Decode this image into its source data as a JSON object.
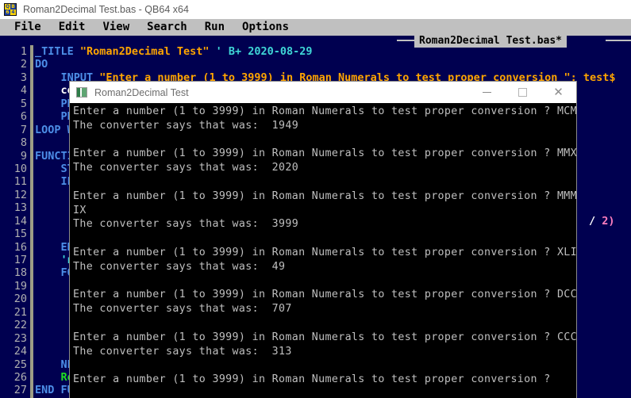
{
  "ide": {
    "title": "Roman2Decimal Test.bas - QB64 x64",
    "icon": "qb64-icon",
    "icon_text": {
      "tl": "Q",
      "tr": "B",
      "bl": "6",
      "br": "4"
    },
    "menu": [
      "File",
      "Edit",
      "View",
      "Search",
      "Run",
      "Options"
    ],
    "file_tab": "Roman2Decimal Test.bas*",
    "colors": {
      "editor_bg": "#000050",
      "menu_bg": "#c0c0c0",
      "keyword": "#4d8fe8",
      "string": "#ffa500",
      "comment": "#3fd7d7",
      "function": "#20e020",
      "gutter_text": "#b0b0b0"
    },
    "gutter_lines": [
      "1",
      "2",
      "3",
      "4",
      "5",
      "6",
      "7",
      "8",
      "9",
      "10",
      "11",
      "12",
      "13",
      "14",
      "15",
      "16",
      "17",
      "18",
      "19",
      "20",
      "21",
      "22",
      "23",
      "24",
      "25",
      "26",
      "27"
    ],
    "code_lines": [
      {
        "n": "1",
        "segments": [
          {
            "t": "_TITLE ",
            "c": "kw"
          },
          {
            "t": "\"Roman2Decimal Test\"",
            "c": "str"
          },
          {
            "t": " ' B+ 2020-08-29",
            "c": "com"
          }
        ]
      },
      {
        "n": "2",
        "segments": [
          {
            "t": "DO",
            "c": "kw"
          }
        ]
      },
      {
        "n": "3",
        "segments": [
          {
            "t": "    INPUT ",
            "c": "kw"
          },
          {
            "t": "\"Enter a number (1 to 3999) in Roman Numerals to test proper conversion \"; test$",
            "c": "str"
          }
        ]
      },
      {
        "n": "4",
        "segments": [
          {
            "t": "    con",
            "c": "plain"
          }
        ]
      },
      {
        "n": "5",
        "segments": [
          {
            "t": "    PRI",
            "c": "kw"
          }
        ]
      },
      {
        "n": "6",
        "segments": [
          {
            "t": "    PRI",
            "c": "kw"
          }
        ]
      },
      {
        "n": "7",
        "segments": [
          {
            "t": "LOOP WH",
            "c": "kw"
          }
        ]
      },
      {
        "n": "8",
        "segments": [
          {
            "t": "",
            "c": "kw"
          }
        ]
      },
      {
        "n": "9",
        "segments": [
          {
            "t": "FUNCTIO",
            "c": "kw"
          }
        ]
      },
      {
        "n": "10",
        "segments": [
          {
            "t": "    STA",
            "c": "kw"
          }
        ]
      },
      {
        "n": "11",
        "segments": [
          {
            "t": "    IF ",
            "c": "kw"
          }
        ]
      },
      {
        "n": "12",
        "segments": [
          {
            "t": "",
            "c": "kw"
          }
        ]
      },
      {
        "n": "13",
        "segments": [
          {
            "t": "",
            "c": "kw"
          }
        ]
      },
      {
        "n": "14",
        "segments": [
          {
            "t": "",
            "c": "kw"
          }
        ]
      },
      {
        "n": "15",
        "segments": [
          {
            "t": "",
            "c": "kw"
          }
        ]
      },
      {
        "n": "16",
        "segments": [
          {
            "t": "    END",
            "c": "kw"
          }
        ]
      },
      {
        "n": "17",
        "segments": [
          {
            "t": "    'no",
            "c": "com"
          }
        ]
      },
      {
        "n": "18",
        "segments": [
          {
            "t": "    FOR",
            "c": "kw"
          }
        ]
      },
      {
        "n": "19",
        "segments": [
          {
            "t": "",
            "c": "kw"
          }
        ]
      },
      {
        "n": "20",
        "segments": [
          {
            "t": "",
            "c": "kw"
          }
        ]
      },
      {
        "n": "21",
        "segments": [
          {
            "t": "",
            "c": "kw"
          }
        ]
      },
      {
        "n": "22",
        "segments": [
          {
            "t": "",
            "c": "kw"
          }
        ]
      },
      {
        "n": "23",
        "segments": [
          {
            "t": "",
            "c": "kw"
          }
        ]
      },
      {
        "n": "24",
        "segments": [
          {
            "t": "",
            "c": "kw"
          }
        ]
      },
      {
        "n": "25",
        "segments": [
          {
            "t": "    NEX",
            "c": "kw"
          }
        ]
      },
      {
        "n": "26",
        "segments": [
          {
            "t": "    Roma",
            "c": "fn"
          }
        ]
      },
      {
        "n": "27",
        "segments": [
          {
            "t": "END FUN",
            "c": "kw"
          }
        ]
      }
    ],
    "code_right_fragment": {
      "line": "14",
      "text": "/ 2)",
      "slash_color": "#ffffff",
      "rest_color": "#ff7fbf"
    }
  },
  "console": {
    "title": "Roman2Decimal Test",
    "icon": "console-app-icon",
    "controls": {
      "minimize": "minimize-button",
      "maximize": "maximize-button",
      "close": "close-button"
    },
    "lines": [
      "Enter a number (1 to 3999) in Roman Numerals to test proper conversion ? MCMXLIX",
      "The converter says that was:  1949",
      "",
      "Enter a number (1 to 3999) in Roman Numerals to test proper conversion ? MMXX",
      "The converter says that was:  2020",
      "",
      "Enter a number (1 to 3999) in Roman Numerals to test proper conversion ? MMMCMXC",
      "IX",
      "The converter says that was:  3999",
      "",
      "Enter a number (1 to 3999) in Roman Numerals to test proper conversion ? XLIX",
      "The converter says that was:  49",
      "",
      "Enter a number (1 to 3999) in Roman Numerals to test proper conversion ? DCCVII",
      "The converter says that was:  707",
      "",
      "Enter a number (1 to 3999) in Roman Numerals to test proper conversion ? CCCXIII",
      "The converter says that was:  313",
      "",
      "Enter a number (1 to 3999) in Roman Numerals to test proper conversion ?"
    ]
  }
}
